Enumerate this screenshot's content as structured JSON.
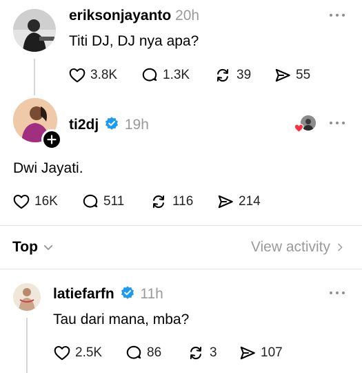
{
  "post1": {
    "username": "eriksonjayanto",
    "time": "20h",
    "text": "Titi DJ, DJ nya apa?",
    "likes": "3.8K",
    "replies": "1.3K",
    "reposts": "39",
    "shares": "55"
  },
  "post2": {
    "username": "ti2dj",
    "time": "19h",
    "text": "Dwi Jayati.",
    "likes": "16K",
    "replies": "511",
    "reposts": "116",
    "shares": "214"
  },
  "sort": {
    "label": "Top",
    "view_activity": "View activity"
  },
  "reply1": {
    "username": "latiefarfn",
    "time": "11h",
    "text": "Tau dari mana, mba?",
    "likes": "2.5K",
    "replies": "86",
    "reposts": "3",
    "shares": "107"
  },
  "colors": {
    "verified": "#1d9bf0",
    "liked_heart": "#ff3040",
    "muted": "#9a9a9a"
  }
}
